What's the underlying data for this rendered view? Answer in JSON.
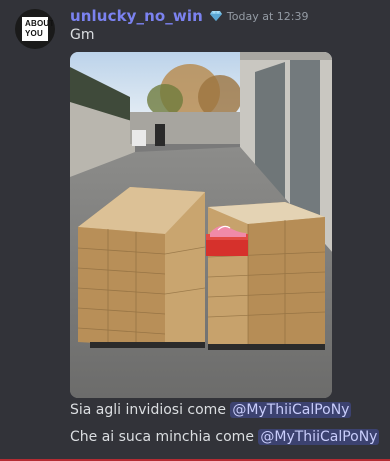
{
  "author": {
    "username": "unlucky_no_win",
    "avatar_text": [
      "ABOUT",
      "YOU"
    ],
    "badge_icon": "gem-icon"
  },
  "timestamp": "Today at 12:39",
  "messages": {
    "first": "Gm",
    "line1_prefix": "Sia agli invidiosi come ",
    "line1_mention": "@MyThiiCalPoNy",
    "line2_prefix": "Che ai suca minchia come ",
    "line2_mention": "@MyThiiCalPoNy"
  },
  "attachment": {
    "type": "photo",
    "subject": "two pallets of stacked sneaker boxes in a courtyard"
  },
  "colors": {
    "background": "#323339",
    "username": "#7b82f0",
    "mention_bg": "#3c4270",
    "mention_text": "#c9cdfb"
  }
}
